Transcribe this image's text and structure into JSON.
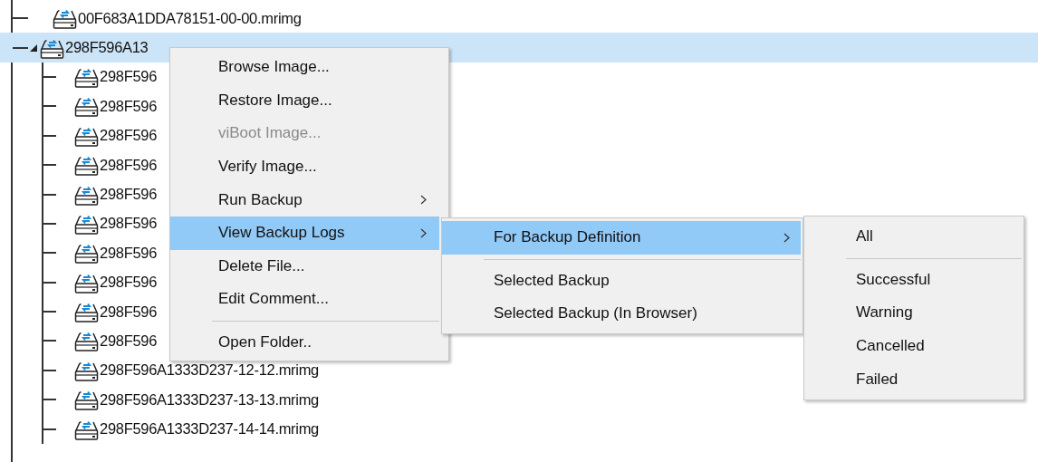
{
  "tree": {
    "items": [
      {
        "label": "00F683A1DDA78151-00-00.mrimg",
        "selected": false,
        "expanded": false
      },
      {
        "label": "298F596A13",
        "selected": true,
        "expanded": true,
        "children": [
          {
            "label": "298F596",
            "selected": false
          },
          {
            "label": "298F596",
            "selected": false
          },
          {
            "label": "298F596",
            "selected": false
          },
          {
            "label": "298F596",
            "selected": false
          },
          {
            "label": "298F596",
            "selected": false
          },
          {
            "label": "298F596",
            "selected": false
          },
          {
            "label": "298F596",
            "selected": false
          },
          {
            "label": "298F596",
            "selected": false
          },
          {
            "label": "298F596",
            "selected": false
          },
          {
            "label": "298F596",
            "selected": false
          },
          {
            "label": "298F596A1333D237-12-12.mrimg",
            "selected": false
          },
          {
            "label": "298F596A1333D237-13-13.mrimg",
            "selected": false
          },
          {
            "label": "298F596A1333D237-14-14.mrimg",
            "selected": false
          }
        ]
      }
    ]
  },
  "context_menu": {
    "items": [
      {
        "kind": "item",
        "label": "Browse Image...",
        "disabled": false,
        "selected": false,
        "has_submenu": false
      },
      {
        "kind": "item",
        "label": "Restore Image...",
        "disabled": false,
        "selected": false,
        "has_submenu": false
      },
      {
        "kind": "item",
        "label": "viBoot Image...",
        "disabled": true,
        "selected": false,
        "has_submenu": false
      },
      {
        "kind": "item",
        "label": "Verify Image...",
        "disabled": false,
        "selected": false,
        "has_submenu": false
      },
      {
        "kind": "item",
        "label": "Run Backup",
        "disabled": false,
        "selected": false,
        "has_submenu": true
      },
      {
        "kind": "item",
        "label": "View Backup Logs",
        "disabled": false,
        "selected": true,
        "has_submenu": true
      },
      {
        "kind": "item",
        "label": "Delete File...",
        "disabled": false,
        "selected": false,
        "has_submenu": false
      },
      {
        "kind": "item",
        "label": "Edit Comment...",
        "disabled": false,
        "selected": false,
        "has_submenu": false
      },
      {
        "kind": "separator"
      },
      {
        "kind": "item",
        "label": "Open Folder..",
        "disabled": false,
        "selected": false,
        "has_submenu": false
      }
    ]
  },
  "submenu": {
    "items": [
      {
        "kind": "item",
        "label": "For Backup Definition",
        "disabled": false,
        "selected": true,
        "has_submenu": true
      },
      {
        "kind": "separator"
      },
      {
        "kind": "item",
        "label": "Selected Backup",
        "disabled": false,
        "selected": false,
        "has_submenu": false
      },
      {
        "kind": "item",
        "label": "Selected Backup (In Browser)",
        "disabled": false,
        "selected": false,
        "has_submenu": false
      }
    ]
  },
  "submenu_2": {
    "items": [
      {
        "kind": "item",
        "label": "All",
        "disabled": false,
        "selected": false,
        "has_submenu": false
      },
      {
        "kind": "separator"
      },
      {
        "kind": "item",
        "label": "Successful",
        "disabled": false,
        "selected": false,
        "has_submenu": false
      },
      {
        "kind": "item",
        "label": "Warning",
        "disabled": false,
        "selected": false,
        "has_submenu": false
      },
      {
        "kind": "item",
        "label": "Cancelled",
        "disabled": false,
        "selected": false,
        "has_submenu": false
      },
      {
        "kind": "item",
        "label": "Failed",
        "disabled": false,
        "selected": false,
        "has_submenu": false
      }
    ]
  }
}
